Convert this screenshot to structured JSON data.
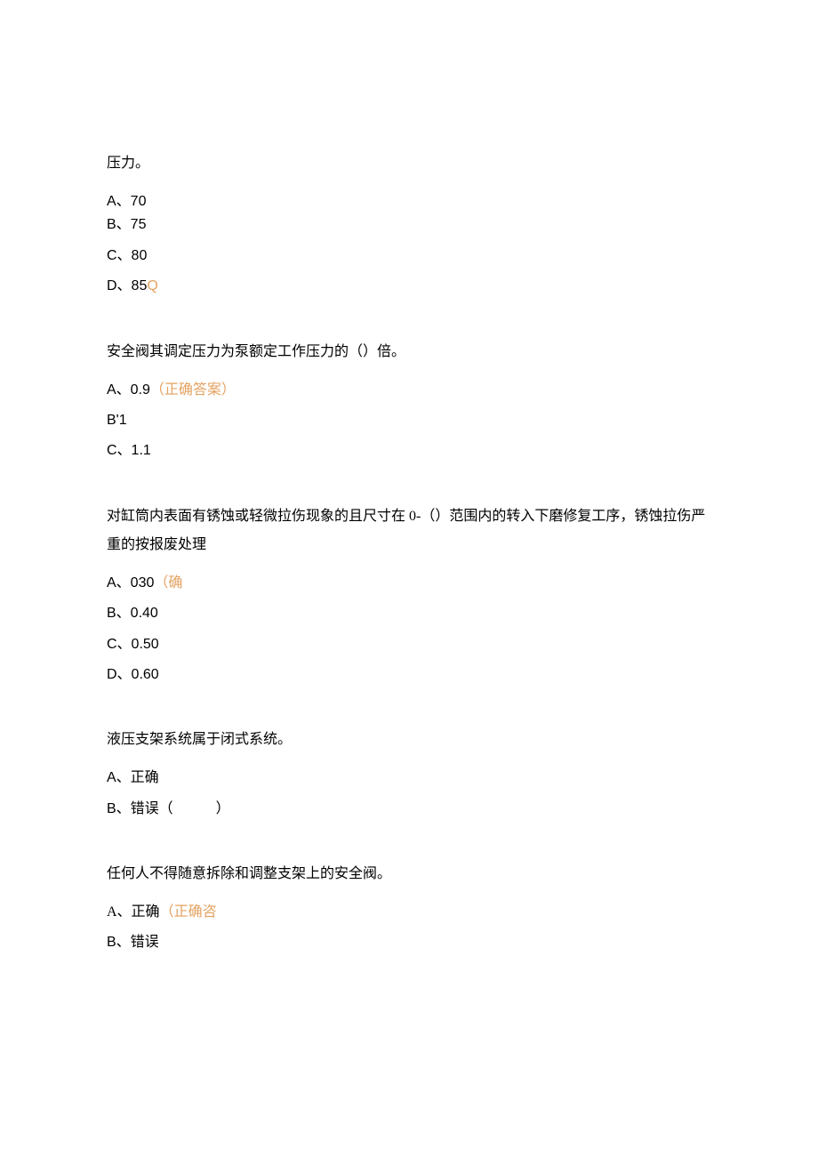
{
  "q1": {
    "stem": "压力。",
    "optA": "A、70",
    "optB": "B、75",
    "optC": "C、80",
    "optD_prefix": "D、85",
    "optD_accent": "Q"
  },
  "q2": {
    "stem": "安全阀其调定压力为泵额定工作压力的（）倍。",
    "optA_prefix": "A、0.9",
    "optA_accent": "（正确答案）",
    "optB": "B'1",
    "optC": "C、1.1"
  },
  "q3": {
    "stem": "对缸筒内表面有锈蚀或轻微拉伤现象的且尺寸在 0-（）范围内的转入下磨修复工序，锈蚀拉伤严重的按报废处理",
    "optA_prefix": "A、030",
    "optA_accent": "（确",
    "optB": "B、0.40",
    "optC": "C、0.50",
    "optD": "D、0.60"
  },
  "q4": {
    "stem": "液压支架系统属于闭式系统。",
    "optA": "A、正确",
    "optB": "B、错误（　　　）"
  },
  "q5": {
    "stem": "任何人不得随意拆除和调整支架上的安全阀。",
    "optA_prefix": "A、正确",
    "optA_accent": "（正确咨",
    "optB": "B、错误"
  }
}
